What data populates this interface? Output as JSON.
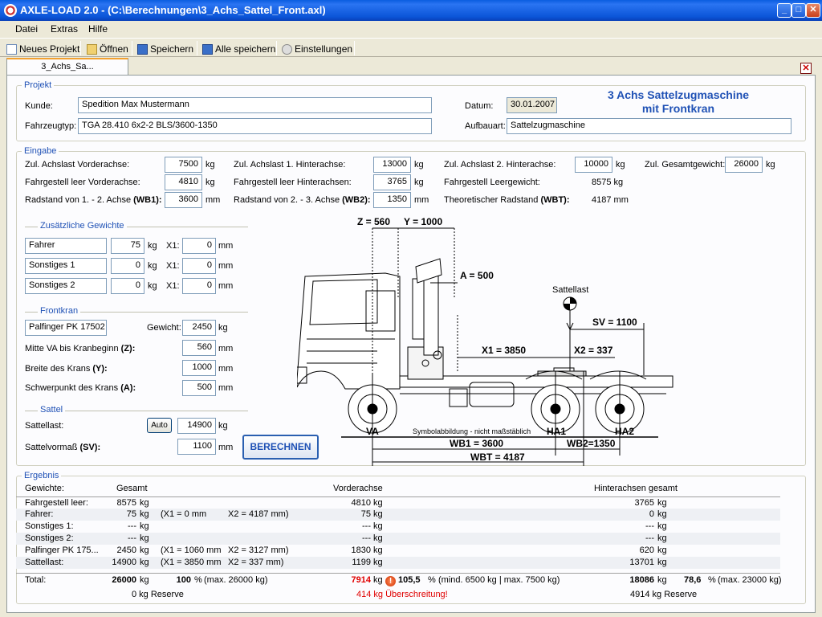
{
  "window": {
    "title": "AXLE-LOAD 2.0 - (C:\\Berechnungen\\3_Achs_Sattel_Front.axl)",
    "btn_min": "_",
    "btn_max": "□",
    "btn_close": "✕"
  },
  "menu": [
    "Datei",
    "Extras",
    "Hilfe"
  ],
  "toolbar": {
    "new": "Neues Projekt",
    "open": "Öffnen",
    "save": "Speichern",
    "save_all": "Alle speichern",
    "settings": "Einstellungen"
  },
  "tab": {
    "label": "3_Achs_Sa...",
    "close": "✕"
  },
  "projekt": {
    "group": "Projekt",
    "kunde_label": "Kunde:",
    "kunde": "Spedition Max Mustermann",
    "typ_label": "Fahrzeugtyp:",
    "typ": "TGA 28.410 6x2-2 BLS/3600-1350",
    "datum_label": "Datum:",
    "datum": "30.01.2007",
    "aufbau_label": "Aufbauart:",
    "aufbau": "Sattelzugmaschine",
    "heading_1": "3 Achs Sattelzugmaschine",
    "heading_2": "mit Frontkran"
  },
  "eingabe": {
    "group": "Eingabe",
    "va_label": "Zul. Achslast Vorderachse:",
    "va": "7500",
    "ha1_label": "Zul. Achslast 1. Hinterachse:",
    "ha1": "13000",
    "ha2_label": "Zul. Achslast 2. Hinterachse:",
    "ha2": "10000",
    "gg_label": "Zul. Gesamtgewicht:",
    "gg": "26000",
    "leer_va_label": "Fahrgestell leer Vorderachse:",
    "leer_va": "4810",
    "leer_ha_label": "Fahrgestell leer Hinterachsen:",
    "leer_ha": "3765",
    "leergew_label": "Fahrgestell Leergewicht:",
    "leergew": "8575 kg",
    "wb1_label_a": "Radstand von 1. - 2. Achse ",
    "wb1_label_b": "(WB1):",
    "wb1": "3600",
    "wb2_label_a": "Radstand von 2. - 3. Achse ",
    "wb2_label_b": "(WB2):",
    "wb2": "1350",
    "wbt_label_a": "Theoretischer Radstand ",
    "wbt_label_b": "(WBT):",
    "wbt": "4187 mm",
    "unit_kg": "kg",
    "unit_mm": "mm"
  },
  "zusatz": {
    "group": "Zusätzliche Gewichte",
    "x1": "X1:",
    "rows": [
      {
        "name": "Fahrer",
        "kg": "75",
        "x": "0"
      },
      {
        "name": "Sonstiges 1",
        "kg": "0",
        "x": "0"
      },
      {
        "name": "Sonstiges 2",
        "kg": "0",
        "x": "0"
      }
    ]
  },
  "frontkran": {
    "group": "Frontkran",
    "name": "Palfinger PK 17502",
    "gewicht_label": "Gewicht:",
    "gewicht": "2450",
    "z_label_a": "Mitte VA bis Kranbeginn ",
    "z_label_b": "(Z):",
    "z": "560",
    "y_label_a": "Breite des Krans ",
    "y_label_b": "(Y):",
    "y": "1000",
    "a_label_a": "Schwerpunkt des Krans ",
    "a_label_b": "(A):",
    "a": "500"
  },
  "sattel": {
    "group": "Sattel",
    "last_label": "Sattellast:",
    "auto": "Auto",
    "last": "14900",
    "sv_label_a": "Sattelvormaß ",
    "sv_label_b": "(SV):",
    "sv": "1100",
    "calc": "BERECHNEN"
  },
  "drawing": {
    "z": "Z = 560",
    "y": "Y = 1000",
    "a": "A = 500",
    "sattellast": "Sattellast",
    "sv": "SV = 1100",
    "x1": "X1 = 3850",
    "x2": "X2 = 337",
    "va": "VA",
    "ha1": "HA1",
    "ha2": "HA2",
    "note": "Symbolabbildung - nicht maßstäblich",
    "wb1": "WB1 = 3600",
    "wb2": "WB2=1350",
    "wbt": "WBT = 4187"
  },
  "ergebnis": {
    "group": "Ergebnis",
    "headers": {
      "gew": "Gewichte:",
      "gesamt": "Gesamt",
      "va": "Vorderachse",
      "ha": "Hinterachsen gesamt"
    },
    "rows": [
      {
        "name": "Fahrgestell leer:",
        "ges": "8575",
        "gu": "kg",
        "x1": "",
        "x2": "",
        "va": "4810",
        "vu": "kg",
        "ha": "3765",
        "hu": "kg"
      },
      {
        "name": "Fahrer:",
        "ges": "75",
        "gu": "kg",
        "x1": "(X1 = 0 mm",
        "x2": "X2 = 4187 mm)",
        "va": "75",
        "vu": "kg",
        "ha": "0",
        "hu": "kg"
      },
      {
        "name": "Sonstiges 1:",
        "ges": "---",
        "gu": "kg",
        "x1": "",
        "x2": "",
        "va": "---",
        "vu": "kg",
        "ha": "---",
        "hu": "kg"
      },
      {
        "name": "Sonstiges 2:",
        "ges": "---",
        "gu": "kg",
        "x1": "",
        "x2": "",
        "va": "---",
        "vu": "kg",
        "ha": "---",
        "hu": "kg"
      },
      {
        "name": "Palfinger PK 175...",
        "ges": "2450",
        "gu": "kg",
        "x1": "(X1 = 1060 mm",
        "x2": "X2 = 3127 mm)",
        "va": "1830",
        "vu": "kg",
        "ha": "620",
        "hu": "kg"
      },
      {
        "name": "Sattellast:",
        "ges": "14900",
        "gu": "kg",
        "x1": "(X1 = 3850 mm",
        "x2": "X2 = 337 mm)",
        "va": "1199",
        "vu": "kg",
        "ha": "13701",
        "hu": "kg"
      }
    ],
    "total": {
      "label": "Total:",
      "ges": "26000",
      "gu": "kg",
      "gp": "100",
      "pct": "%",
      "gmax": "(max. 26000 kg)",
      "va": "7914",
      "vu": "kg",
      "warn": "!",
      "vp": "105,5",
      "vmax": "(mind. 6500 kg | max. 7500 kg)",
      "ha": "18086",
      "hu": "kg",
      "hp": "78,6",
      "hmax": "(max. 23000 kg)",
      "ges_res": "0 kg Reserve",
      "va_res": "414 kg Überschreitung!",
      "ha_res": "4914 kg Reserve"
    }
  }
}
